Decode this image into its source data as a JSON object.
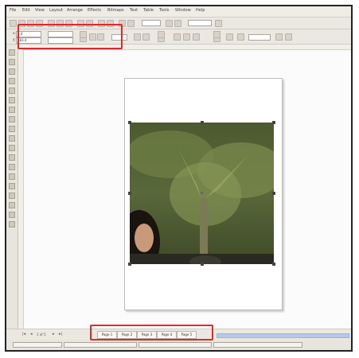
{
  "menubar": {
    "items": [
      "File",
      "Edit",
      "View",
      "Layout",
      "Arrange",
      "Effects",
      "Bitmaps",
      "Text",
      "Table",
      "Tools",
      "Window",
      "Help"
    ]
  },
  "propertybar": {
    "x_value": "4.4",
    "y_value": "183.4",
    "width_value": "",
    "height_value": ""
  },
  "page_tabs": [
    "Page 1",
    "Page 2",
    "Page 3",
    "Page 4",
    "Page 5"
  ],
  "status": {
    "page_counter": "1 of 5",
    "current_page": "Page 1"
  },
  "accent": {
    "highlight": "#e0282a",
    "scroll": "#b8c9e8"
  },
  "icons": [
    "pick-tool-icon",
    "shape-tool-icon",
    "zoom-tool-icon",
    "freehand-tool-icon",
    "rectangle-tool-icon",
    "ellipse-tool-icon",
    "text-tool-icon",
    "fill-tool-icon"
  ]
}
